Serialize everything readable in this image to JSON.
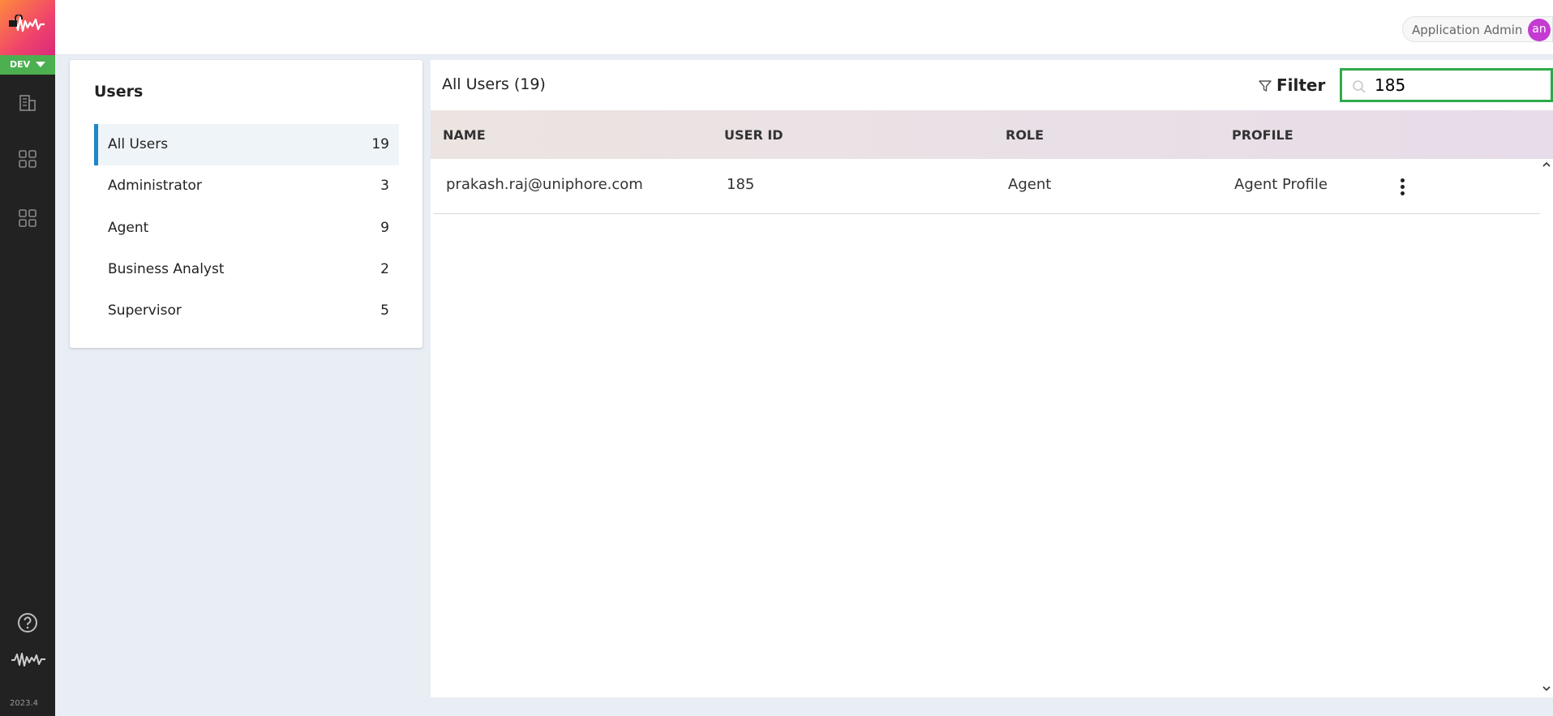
{
  "app": {
    "environment": "DEV",
    "version": "2023.4",
    "user_name": "Application Admin",
    "user_initials": "an"
  },
  "sidebar": {
    "icons": [
      "building-icon",
      "apps-grid-icon",
      "apps-grid-icon",
      "help-icon",
      "waveform-logo-icon"
    ]
  },
  "users_panel": {
    "title": "Users",
    "roles": [
      {
        "label": "All Users",
        "count": "19"
      },
      {
        "label": "Administrator",
        "count": "3"
      },
      {
        "label": "Agent",
        "count": "9"
      },
      {
        "label": "Business Analyst",
        "count": "2"
      },
      {
        "label": "Supervisor",
        "count": "5"
      }
    ]
  },
  "main": {
    "title": "All Users (19)",
    "filter_label": "Filter",
    "search_value": "185",
    "columns": [
      "NAME",
      "USER ID",
      "ROLE",
      "PROFILE"
    ],
    "rows": [
      {
        "name": "prakash.raj@uniphore.com",
        "user_id": "185",
        "role": "Agent",
        "profile": "Agent Profile"
      }
    ]
  },
  "colors": {
    "accent": "#1c86c8",
    "env_badge": "#4caf50",
    "search_focus": "#2eaa4a",
    "avatar": "#c43bd1"
  }
}
